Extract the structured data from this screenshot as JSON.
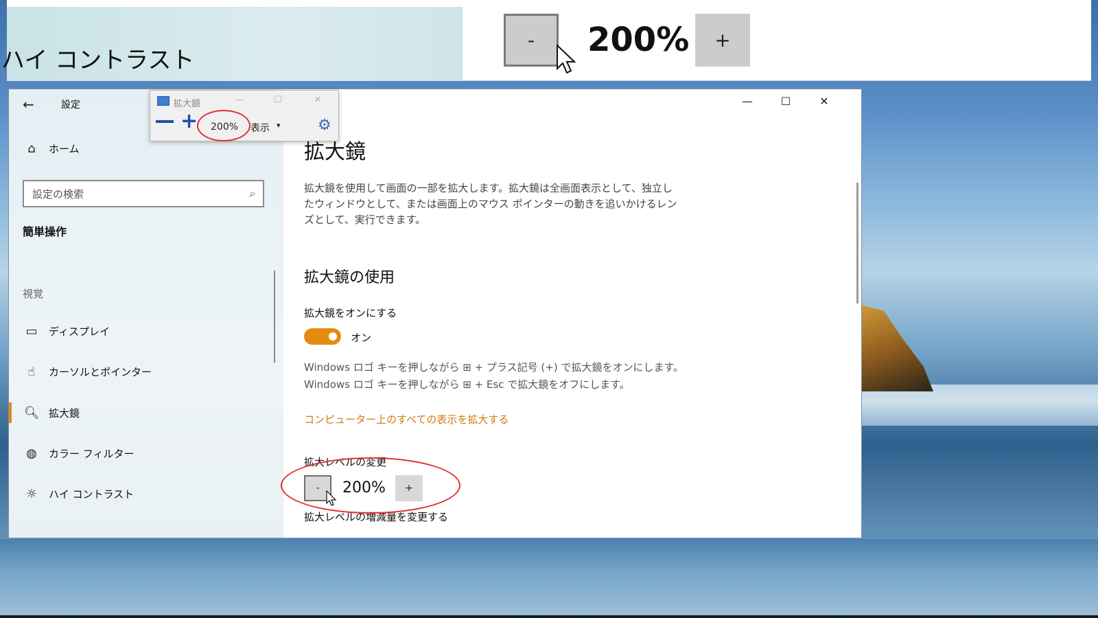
{
  "docked_magnifier": {
    "heading_fragment": "ハイ コントラスト",
    "minus_label": "-",
    "zoom_value": "200%",
    "plus_label": "+"
  },
  "settings_window": {
    "app_title": "設定",
    "window_controls": {
      "minimize": "—",
      "maximize": "☐",
      "close": "✕"
    },
    "sidebar": {
      "home_label": "ホーム",
      "search_placeholder": "設定の検索",
      "section_title": "簡単操作",
      "group_label": "視覚",
      "items": [
        {
          "label": "ディスプレイ",
          "icon": "display-icon"
        },
        {
          "label": "カーソルとポインター",
          "icon": "cursor-icon"
        },
        {
          "label": "拡大鏡",
          "icon": "magnifier-icon",
          "active": true
        },
        {
          "label": "カラー フィルター",
          "icon": "palette-icon"
        },
        {
          "label": "ハイ コントラスト",
          "icon": "brightness-icon"
        }
      ],
      "accent_color": "#e58b10"
    },
    "main": {
      "page_title": "拡大鏡",
      "description": "拡大鏡を使用して画面の一部を拡大します。拡大鏡は全画面表示として、独立したウィンドウとして、または画面上のマウス ポインターの動きを追いかけるレンズとして、実行できます。",
      "section_title": "拡大鏡の使用",
      "toggle_label": "拡大鏡をオンにする",
      "toggle_state": "オン",
      "hint_on": "Windows ロゴ キーを押しながら ⊞ + プラス記号 (+) で拡大鏡をオンにします。",
      "hint_off": "Windows ロゴ キーを押しながら ⊞ + Esc で拡大鏡をオフにします。",
      "link_text": "コンピューター上のすべての表示を拡大する",
      "zoom_level_label": "拡大レベルの変更",
      "zoom_minus": "-",
      "zoom_value": "200%",
      "zoom_plus": "+",
      "increment_label": "拡大レベルの増減量を変更する"
    }
  },
  "magnifier_toolbar": {
    "title": "拡大鏡",
    "zoom_value": "200%",
    "view_label": "表示",
    "caret": "▾",
    "window_controls": {
      "minimize": "—",
      "maximize": "☐",
      "close": "✕"
    }
  },
  "highlight_color": "#e03030"
}
